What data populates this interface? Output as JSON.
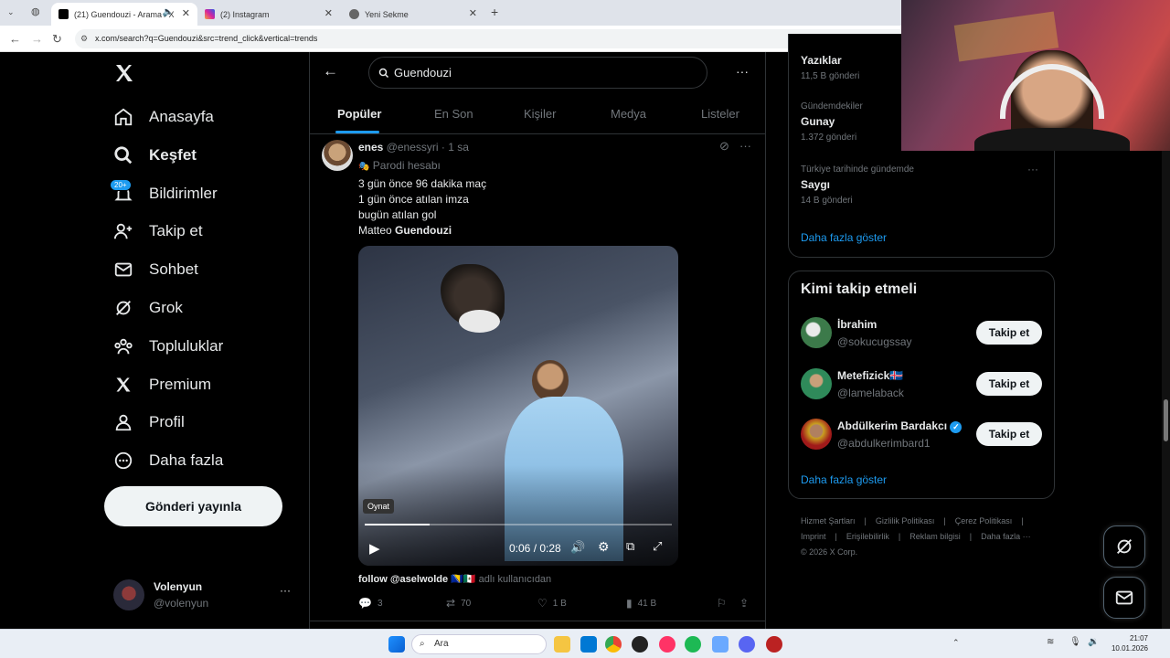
{
  "browser": {
    "tabs": [
      {
        "title": "(21) Guendouzi - Arama / X",
        "active": true
      },
      {
        "title": "(2) Instagram",
        "active": false
      },
      {
        "title": "Yeni Sekme",
        "active": false
      }
    ],
    "url": "x.com/search?q=Guendouzi&src=trend_click&vertical=trends"
  },
  "sidebar": {
    "items": [
      {
        "label": "Anasayfa",
        "icon": "home-icon"
      },
      {
        "label": "Keşfet",
        "icon": "search-icon"
      },
      {
        "label": "Bildirimler",
        "icon": "bell-icon"
      },
      {
        "label": "Takip et",
        "icon": "follow-icon"
      },
      {
        "label": "Sohbet",
        "icon": "mail-icon"
      },
      {
        "label": "Grok",
        "icon": "grok-icon"
      },
      {
        "label": "Topluluklar",
        "icon": "communities-icon"
      },
      {
        "label": "Premium",
        "icon": "x-icon"
      },
      {
        "label": "Profil",
        "icon": "person-icon"
      },
      {
        "label": "Daha fazla",
        "icon": "more-circle-icon"
      }
    ],
    "notification_badge": "20+",
    "post_button": "Gönderi yayınla",
    "account": {
      "name": "Volenyun",
      "handle": "@volenyun"
    }
  },
  "search": {
    "query": "Guendouzi",
    "tabs": [
      "Popüler",
      "En Son",
      "Kişiler",
      "Medya",
      "Listeler"
    ]
  },
  "tweet": {
    "author": "enes",
    "handle": "@enessyri",
    "time": "· 1 sa",
    "label": "Parodi hesabı",
    "lines": [
      "3 gün önce 96 dakika maç",
      "1 gün önce atılan imza",
      "bugün atılan gol"
    ],
    "last_line_prefix": "Matteo ",
    "last_line_bold": "Guendouzi",
    "video": {
      "tooltip": "Oynat",
      "time": "0:06 / 0:28",
      "progress": 0.21
    },
    "next_line": "follow @aselwolde",
    "next_line_suffix": "adlı kullanıcıdan",
    "actions": {
      "replies": "3",
      "retweets": "70",
      "likes": "1 B",
      "views": "41 B"
    }
  },
  "trends": [
    {
      "sub": "",
      "title": "Yazıklar",
      "count": "11,5 B gönderi"
    },
    {
      "sub": "Gündemdekiler",
      "title": "Gunay",
      "count": "1.372 gönderi"
    },
    {
      "sub": "Türkiye tarihinde gündemde",
      "title": "Saygı",
      "count": "14 B gönderi"
    }
  ],
  "trends_more": "Daha fazla göster",
  "who_to_follow": {
    "title": "Kimi takip etmeli",
    "users": [
      {
        "name": "İbrahim",
        "handle": "@sokucugssay",
        "button": "Takip et",
        "verified": false
      },
      {
        "name": "Metefizick🇮🇸",
        "handle": "@lamelaback",
        "button": "Takip et",
        "verified": false
      },
      {
        "name": "Abdülkerim Bardakcı",
        "handle": "@abdulkerimbard1",
        "button": "Takip et",
        "verified": true
      }
    ],
    "more": "Daha fazla göster"
  },
  "footer": {
    "links": [
      "Hizmet Şartları",
      "Gizlilik Politikası",
      "Çerez Politikası",
      "Imprint",
      "Erişilebilirlik",
      "Reklam bilgisi",
      "Daha fazla ···"
    ],
    "copyright": "© 2026 X Corp."
  },
  "taskbar": {
    "search": "Ara",
    "time": "21:07",
    "date": "10.01.2026"
  },
  "colors": {
    "accent": "#1d9bf0",
    "background": "#000000",
    "muted": "#71767b"
  }
}
